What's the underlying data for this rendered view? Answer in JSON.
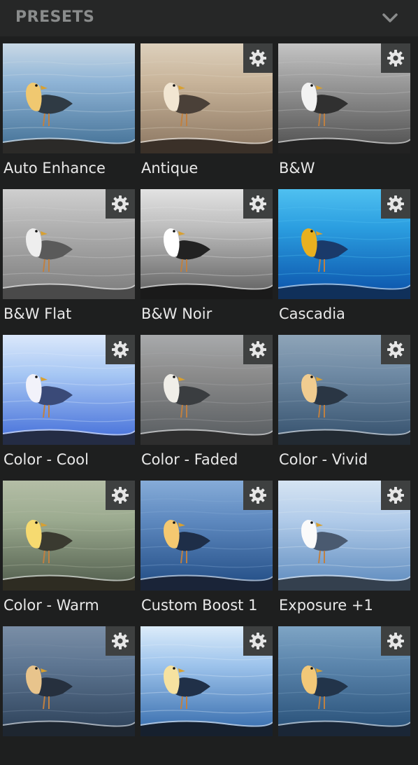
{
  "panel": {
    "title": "PRESETS",
    "collapse_icon": "chevron-down-icon"
  },
  "presets": [
    {
      "label": "Auto Enhance",
      "settings_icon": false,
      "water_top": "#8fb4d6",
      "water_bottom": "#3f6d92",
      "sky": "#c9d9e6",
      "bird_head": "#f0c870",
      "bird_body": "#2f3a44",
      "shore": "#2b2a28"
    },
    {
      "label": "Antique",
      "settings_icon": true,
      "water_top": "#c8b49a",
      "water_bottom": "#8a7560",
      "sky": "#ddd0bc",
      "bird_head": "#f2e6d2",
      "bird_body": "#4a4038",
      "shore": "#3a3028"
    },
    {
      "label": "B&W",
      "settings_icon": true,
      "water_top": "#9a9a9a",
      "water_bottom": "#4c4c4c",
      "sky": "#c4c4c4",
      "bird_head": "#f2f2f2",
      "bird_body": "#303030",
      "shore": "#222222"
    },
    {
      "label": "B&W Flat",
      "settings_icon": true,
      "water_top": "#b0b0b0",
      "water_bottom": "#7a7a7a",
      "sky": "#cfcfcf",
      "bird_head": "#eeeeee",
      "bird_body": "#5a5a5a",
      "shore": "#4a4a4a"
    },
    {
      "label": "B&W Noir",
      "settings_icon": true,
      "water_top": "#bdbdbd",
      "water_bottom": "#5c5c5c",
      "sky": "#e2e2e2",
      "bird_head": "#ffffff",
      "bird_body": "#222222",
      "shore": "#1a1a1a"
    },
    {
      "label": "Cascadia",
      "settings_icon": true,
      "water_top": "#2b9ee0",
      "water_bottom": "#0a4fa8",
      "sky": "#4fc0f0",
      "bird_head": "#e8b020",
      "bird_body": "#1a3a6a",
      "shore": "#10305a"
    },
    {
      "label": "Color - Cool",
      "settings_icon": true,
      "water_top": "#a8c8f4",
      "water_bottom": "#3f6ad8",
      "sky": "#dbe8fb",
      "bird_head": "#f2f2fa",
      "bird_body": "#3a4a78",
      "shore": "#242c44"
    },
    {
      "label": "Color - Faded",
      "settings_icon": true,
      "water_top": "#8c8c8c",
      "water_bottom": "#555a5e",
      "sky": "#a8aaac",
      "bird_head": "#f0eee8",
      "bird_body": "#3a3d40",
      "shore": "#2e2e2e"
    },
    {
      "label": "Color - Vivid",
      "settings_icon": true,
      "water_top": "#6f8aa4",
      "water_bottom": "#324e6a",
      "sky": "#8ea4b8",
      "bird_head": "#f0cc90",
      "bird_body": "#2a3644",
      "shore": "#222a32"
    },
    {
      "label": "Color - Warm",
      "settings_icon": true,
      "water_top": "#9cab90",
      "water_bottom": "#4e5a4a",
      "sky": "#b4bea6",
      "bird_head": "#f6da70",
      "bird_body": "#3a3a30",
      "shore": "#2e2c22"
    },
    {
      "label": "Custom Boost 1",
      "settings_icon": true,
      "water_top": "#5f8ac0",
      "water_bottom": "#1f4a82",
      "sky": "#86acd8",
      "bird_head": "#f4c870",
      "bird_body": "#1e2e48",
      "shore": "#1a2438"
    },
    {
      "label": "Exposure +1",
      "settings_icon": true,
      "water_top": "#b2ccea",
      "water_bottom": "#5a88bc",
      "sky": "#d6e4f2",
      "bird_head": "#fafafa",
      "bird_body": "#4a5a70",
      "shore": "#34404e"
    },
    {
      "label": "",
      "settings_icon": true,
      "water_top": "#5e7692",
      "water_bottom": "#2a3e56",
      "sky": "#7a8ea6",
      "bird_head": "#e8c48c",
      "bird_body": "#26303e",
      "shore": "#1e2630"
    },
    {
      "label": "",
      "settings_icon": true,
      "water_top": "#9ec4ec",
      "water_bottom": "#2f66a8",
      "sky": "#dcecfa",
      "bird_head": "#f6e2a0",
      "bird_body": "#203048",
      "shore": "#16202e"
    },
    {
      "label": "",
      "settings_icon": true,
      "water_top": "#5b85ac",
      "water_bottom": "#244c74",
      "sky": "#7ea4c4",
      "bird_head": "#f2c878",
      "bird_body": "#22344a",
      "shore": "#1a2636"
    }
  ]
}
